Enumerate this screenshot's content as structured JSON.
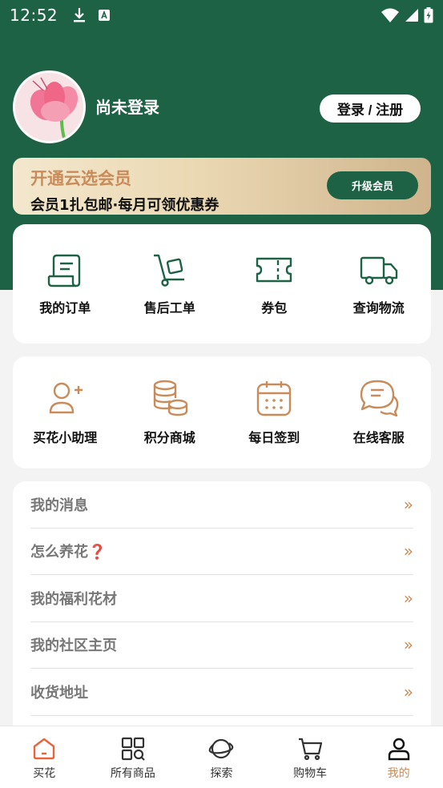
{
  "status_bar": {
    "time": "12:52"
  },
  "profile": {
    "username": "尚未登录",
    "login_label": "登录 / 注册"
  },
  "vip": {
    "title": "开通云选会员",
    "subtitle": "会员1扎包邮·每月可领优惠券",
    "button_label": "升级会员"
  },
  "orders": {
    "items": [
      {
        "label": "我的订单",
        "icon": "order-icon"
      },
      {
        "label": "售后工单",
        "icon": "after-sales-icon"
      },
      {
        "label": "券包",
        "icon": "coupon-icon"
      },
      {
        "label": "查询物流",
        "icon": "truck-icon"
      }
    ]
  },
  "services": {
    "items": [
      {
        "label": "买花小助理",
        "icon": "add-user-icon"
      },
      {
        "label": "积分商城",
        "icon": "coins-icon"
      },
      {
        "label": "每日签到",
        "icon": "calendar-icon"
      },
      {
        "label": "在线客服",
        "icon": "chat-icon"
      }
    ]
  },
  "menu": {
    "items": [
      {
        "label": "我的消息"
      },
      {
        "label": "怎么养花❓"
      },
      {
        "label": "我的福利花材"
      },
      {
        "label": "我的社区主页"
      },
      {
        "label": "收货地址"
      }
    ],
    "chevron": "»"
  },
  "tabbar": {
    "items": [
      {
        "label": "买花",
        "icon": "home-icon"
      },
      {
        "label": "所有商品",
        "icon": "grid-search-icon"
      },
      {
        "label": "探索",
        "icon": "planet-icon"
      },
      {
        "label": "购物车",
        "icon": "cart-icon"
      },
      {
        "label": "我的",
        "icon": "user-icon",
        "active": true
      }
    ]
  },
  "colors": {
    "brand_green": "#1e6246",
    "accent_gold": "#c98b5a",
    "tab_active": "#c98b5a",
    "home_orange": "#e8643a"
  }
}
